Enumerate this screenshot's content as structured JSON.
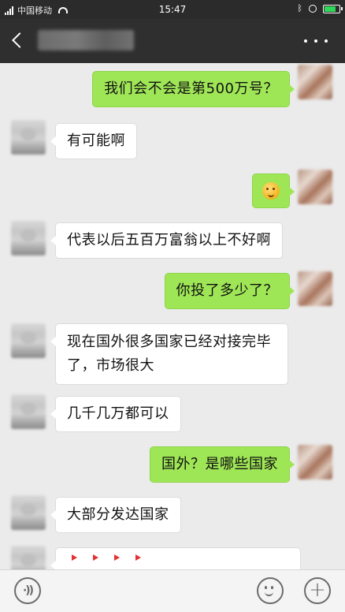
{
  "status_bar": {
    "carrier": "中国移动",
    "time": "15:47",
    "battery_level": 0.9,
    "icons": [
      "signal-icon",
      "wifi-icon",
      "bluetooth-icon",
      "alarm-icon",
      "battery-icon"
    ]
  },
  "nav": {
    "back_icon": "chevron-left-icon",
    "title": "",
    "more_icon": "more-dots-icon"
  },
  "messages": [
    {
      "side": "out",
      "text": "我们会不会是第500万号？"
    },
    {
      "side": "in",
      "text": "有可能啊"
    },
    {
      "side": "out",
      "text": "",
      "emoji": "grinning-emoji-icon"
    },
    {
      "side": "in",
      "text": "代表以后五百万富翁以上不好啊"
    },
    {
      "side": "out",
      "text": "你投了多少了？"
    },
    {
      "side": "in",
      "text": "现在国外很多国家已经对接完毕了，市场很大"
    },
    {
      "side": "in",
      "text": "几千几万都可以"
    },
    {
      "side": "out",
      "text": "国外？是哪些国家"
    },
    {
      "side": "in",
      "text": "大部分发达国家"
    },
    {
      "side": "in",
      "text": "",
      "partial_icon": "red-arrows-icon"
    }
  ],
  "input_bar": {
    "voice_icon": "voice-icon",
    "emoji_icon": "emoji-icon",
    "plus_icon": "plus-icon",
    "plus_glyph": "+"
  },
  "colors": {
    "status_bar_bg": "#2b2b2b",
    "nav_bg": "#2f2f2f",
    "chat_bg": "#ebebeb",
    "out_bubble": "#9fe657",
    "in_bubble": "#ffffff"
  }
}
